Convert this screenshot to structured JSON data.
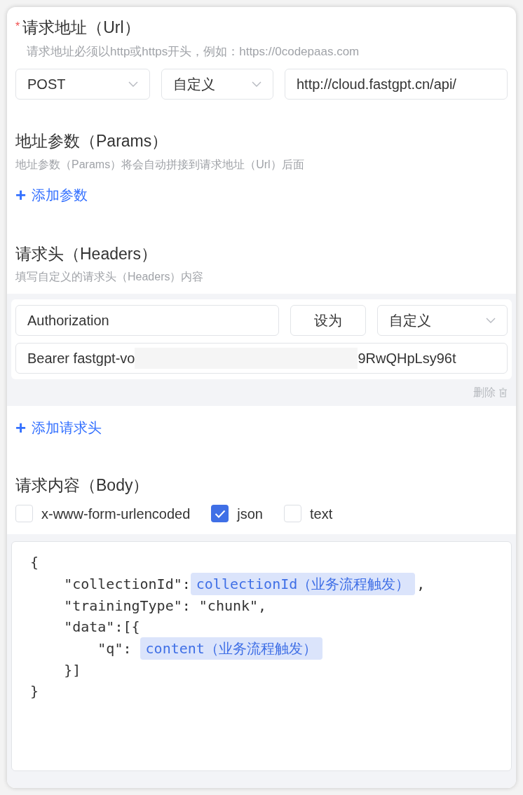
{
  "url_section": {
    "required_mark": "*",
    "title": "请求地址（Url）",
    "hint": "请求地址必须以http或https开头，例如：https://0codepaas.com",
    "method": {
      "value": "POST"
    },
    "mode": {
      "value": "自定义"
    },
    "url": {
      "value": "http://cloud.fastgpt.cn/api/"
    }
  },
  "params_section": {
    "title": "地址参数（Params）",
    "hint": "地址参数（Params）将会自动拼接到请求地址（Url）后面",
    "add_button": {
      "icon": "+",
      "label": "添加参数"
    }
  },
  "headers_section": {
    "title": "请求头（Headers）",
    "hint": "填写自定义的请求头（Headers）内容",
    "headers": [
      {
        "key": "Authorization",
        "set_as": "设为",
        "mode": "自定义",
        "value_start": "Bearer fastgpt-vo",
        "value_end": "9RwQHpLsy96t",
        "delete_label": "删除"
      }
    ],
    "add_button": {
      "icon": "+",
      "label": "添加请求头"
    }
  },
  "body_section": {
    "title": "请求内容（Body）",
    "types": [
      {
        "label": "x-www-form-urlencoded",
        "selected": false
      },
      {
        "label": "json",
        "selected": true
      },
      {
        "label": "text",
        "selected": false
      }
    ],
    "lines": [
      [
        {
          "kind": "text",
          "text": "{"
        }
      ],
      [
        {
          "kind": "text",
          "text": "    \"collectionId\":"
        },
        {
          "kind": "variable",
          "text": "collectionId（业务流程触发）"
        },
        {
          "kind": "text",
          "text": ","
        }
      ],
      [
        {
          "kind": "text",
          "text": "    \"trainingType\": \"chunk\","
        }
      ],
      [
        {
          "kind": "text",
          "text": "    \"data\":[{"
        }
      ],
      [
        {
          "kind": "text",
          "text": "        \"q\": "
        },
        {
          "kind": "variable",
          "text": "content（业务流程触发）"
        }
      ],
      [
        {
          "kind": "text",
          "text": "    }]"
        }
      ],
      [
        {
          "kind": "text",
          "text": "}"
        }
      ]
    ]
  }
}
